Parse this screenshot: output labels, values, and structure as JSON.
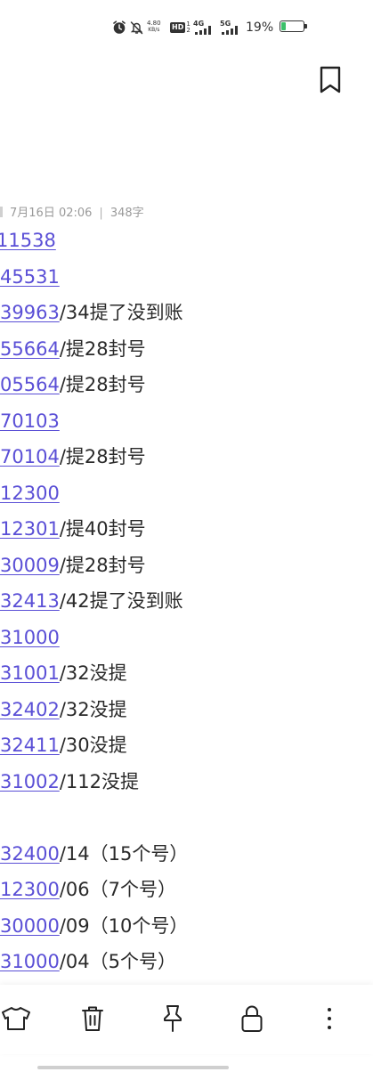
{
  "status_bar": {
    "net_speed_value": "4.80",
    "net_speed_unit": "KB/s",
    "hd_label": "HD",
    "sim1_label": "4G",
    "sim2_label": "5G",
    "battery_percent": "19%",
    "battery_level": 0.19,
    "colors": {
      "battery_fill": "#3cc06a",
      "icon": "#333333"
    }
  },
  "header": {
    "bookmark_icon": "bookmark-icon"
  },
  "meta": {
    "date": "7月16日 02:06",
    "separator": "|",
    "word_count": "348字"
  },
  "lines": [
    {
      "link": "11538",
      "text": ""
    },
    {
      "link": "45531",
      "text": ""
    },
    {
      "link": "39963",
      "text": "/34提了没到账"
    },
    {
      "link": "55664",
      "text": "/提28封号"
    },
    {
      "link": "05564",
      "text": "/提28封号"
    },
    {
      "link": "70103",
      "text": ""
    },
    {
      "link": "70104",
      "text": "/提28封号"
    },
    {
      "link": "12300",
      "text": ""
    },
    {
      "link": "12301",
      "text": "/提40封号"
    },
    {
      "link": "30009",
      "text": "/提28封号"
    },
    {
      "link": "32413",
      "text": "/42提了没到账"
    },
    {
      "link": "31000",
      "text": ""
    },
    {
      "link": "31001",
      "text": "/32没提"
    },
    {
      "link": "32402",
      "text": "/32没提"
    },
    {
      "link": "32411",
      "text": "/30没提"
    },
    {
      "link": "31002",
      "text": "/112没提"
    },
    {
      "link": "",
      "text": ""
    },
    {
      "link": "32400",
      "text": "/14（15个号）"
    },
    {
      "link": "12300",
      "text": "/06（7个号）"
    },
    {
      "link": "30000",
      "text": "/09（10个号）"
    },
    {
      "link": "31000",
      "text": "/04（5个号）"
    }
  ],
  "toolbar": {
    "items": [
      {
        "icon": "shirt-icon"
      },
      {
        "icon": "trash-icon"
      },
      {
        "icon": "pin-icon"
      },
      {
        "icon": "lock-icon"
      },
      {
        "icon": "more-icon"
      }
    ]
  },
  "colors": {
    "link": "#5a4fd6",
    "text": "#2a2a2a",
    "meta": "#9a9a9a"
  }
}
